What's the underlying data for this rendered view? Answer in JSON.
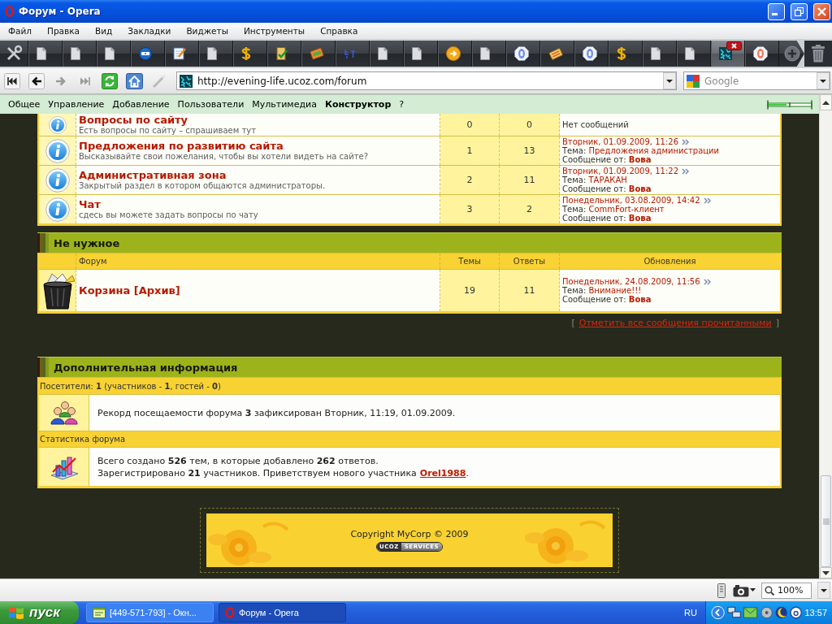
{
  "window": {
    "title": "Форум - Opera"
  },
  "menu": [
    "Файл",
    "Правка",
    "Вид",
    "Закладки",
    "Виджеты",
    "Инструменты",
    "Справка"
  ],
  "tabs": [
    {
      "kind": "page",
      "selected": false
    },
    {
      "kind": "page",
      "selected": false
    },
    {
      "kind": "page",
      "selected": false
    },
    {
      "kind": "disc",
      "selected": false
    },
    {
      "kind": "notepad",
      "selected": false
    },
    {
      "kind": "page",
      "selected": false
    },
    {
      "kind": "dollar",
      "selected": false
    },
    {
      "kind": "checklist",
      "selected": false
    },
    {
      "kind": "wallet",
      "selected": false
    },
    {
      "kind": "sprite",
      "selected": false
    },
    {
      "kind": "page",
      "selected": false
    },
    {
      "kind": "page",
      "selected": false
    },
    {
      "kind": "arrow",
      "selected": false
    },
    {
      "kind": "page",
      "selected": false
    },
    {
      "kind": "octagon",
      "selected": false
    },
    {
      "kind": "card",
      "selected": false
    },
    {
      "kind": "octagon",
      "selected": false
    },
    {
      "kind": "dollar",
      "selected": false
    },
    {
      "kind": "page",
      "selected": false
    },
    {
      "kind": "page",
      "selected": false
    },
    {
      "kind": "mosaic",
      "selected": true
    },
    {
      "kind": "octagonred",
      "selected": false
    }
  ],
  "address_bar": {
    "url": "http://evening-life.ucoz.com/forum"
  },
  "search": {
    "placeholder": "Google"
  },
  "admin_panel": {
    "items": [
      {
        "label": "Общее",
        "selected": false
      },
      {
        "label": "Управление",
        "selected": false
      },
      {
        "label": "Добавление",
        "selected": false
      },
      {
        "label": "Пользователи",
        "selected": false
      },
      {
        "label": "Мультимедиа",
        "selected": false
      },
      {
        "label": "Конструктор",
        "selected": true
      },
      {
        "label": "?",
        "selected": false
      }
    ]
  },
  "sections": [
    {
      "rows": [
        {
          "kind": "info",
          "title": "Вопросы по сайту",
          "description": "Есть вопросы по сайту – спрашиваем тут",
          "topics": "0",
          "replies": "0",
          "last_post": {
            "empty": "Нет сообщений"
          }
        },
        {
          "kind": "info",
          "title": "Предложения по развитию сайта",
          "description": "Высказывайте свои пожелания, чтобы вы хотели видеть на сайте?",
          "topics": "1",
          "replies": "13",
          "last_post": {
            "date": "Вторник, 01.09.2009, 11:26",
            "topic_label": "Тема:",
            "topic": "Предложения администрации",
            "author_label": "Сообщение от:",
            "author": "Вова"
          }
        },
        {
          "kind": "info",
          "title": "Административная зона",
          "description": "Закрытый раздел в котором общаются администраторы.",
          "topics": "2",
          "replies": "11",
          "last_post": {
            "date": "Вторник, 01.09.2009, 11:22",
            "topic_label": "Тема:",
            "topic": "ТАРАКАН",
            "author_label": "Сообщение от:",
            "author": "Вова"
          }
        },
        {
          "kind": "info",
          "title": "Чат",
          "description": "сдесь вы можете задать вопросы по чату",
          "topics": "3",
          "replies": "2",
          "last_post": {
            "date": "Понедельник, 03.08.2009, 14:42",
            "topic_label": "Тема:",
            "topic": "CommFort-клиент",
            "author_label": "Сообщение от:",
            "author": "Вова"
          }
        }
      ]
    },
    {
      "title": "Не нужное",
      "columns": [
        "Форум",
        "Темы",
        "Ответы",
        "Обновления"
      ],
      "rows": [
        {
          "kind": "archive",
          "title": "Корзина [Архив]",
          "topics": "19",
          "replies": "11",
          "last_post": {
            "date": "Понедельник, 24.08.2009, 11:56",
            "topic_label": "Тема:",
            "topic": "Внимание!!!",
            "author_label": "Сообщение от:",
            "author": "Вова"
          }
        }
      ]
    }
  ],
  "mark_read": {
    "open": "[",
    "link": "Отметить все сообщения прочитанными",
    "close": "]"
  },
  "info": {
    "title": "Дополнительная информация",
    "visitors": "Посетители: **1** (участников - **1**, гостей - **0**)",
    "record": "Рекорд посещаемости форума **3** зафиксирован Вторник, 11:19, 01.09.2009.",
    "stats_title": "Статистика форума",
    "stats": {
      "line1": "Всего создано **526** тем, в которые добавлено **262** ответов.",
      "line2": "Зарегистрировано **21** участников. Приветствуем нового участника",
      "new_member": "Orel1988",
      "end": "."
    }
  },
  "footer": {
    "copyright": "Copyright MyCorp © 2009",
    "badge": [
      "UCOZ",
      "SERVICES"
    ]
  },
  "status_bar": {
    "zoom": "100%"
  },
  "taskbar": {
    "start": "пуск",
    "tasks": [
      {
        "kind": "chat",
        "label": "[449-571-793] - Окн...",
        "selected": false
      },
      {
        "kind": "browser",
        "label": "Форум - Opera",
        "selected": true
      }
    ],
    "language": "RU",
    "clock": "13:57"
  }
}
